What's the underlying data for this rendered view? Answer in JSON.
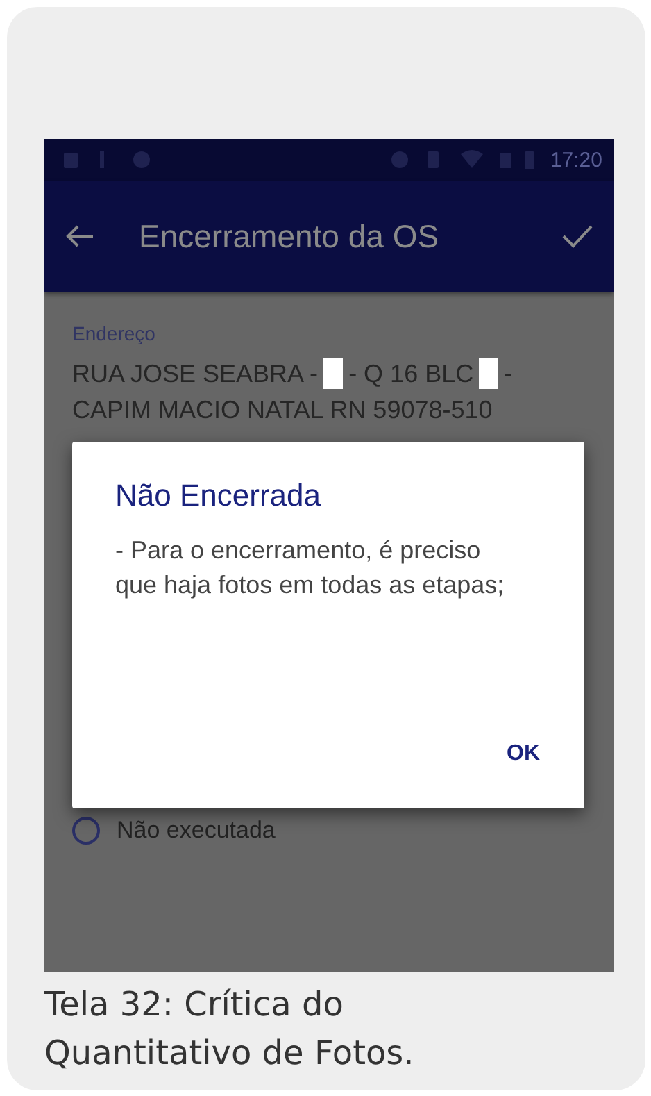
{
  "status_bar": {
    "time": "17:20"
  },
  "app_bar": {
    "title": "Encerramento da OS"
  },
  "address": {
    "label": "Endereço",
    "lines": [
      [
        {
          "kind": "text",
          "text": "RUA JOSE SEABRA -"
        },
        {
          "kind": "redacted"
        },
        {
          "kind": "text",
          "text": "- Q 16 BLC"
        },
        {
          "kind": "redacted"
        },
        {
          "kind": "text",
          "text": "-"
        }
      ],
      [
        {
          "kind": "text",
          "text": "CAPIM MACIO NATAL RN 59078-510"
        }
      ]
    ]
  },
  "options": [
    {
      "label": "Não executada",
      "selected": false
    }
  ],
  "dialog": {
    "title": "Não Encerrada",
    "message": "- Para o encerramento, é preciso que haja fotos em todas as etapas;",
    "buttons": [
      "OK"
    ]
  },
  "caption": "Tela 32: Crítica do Quantitativo de Fotos."
}
